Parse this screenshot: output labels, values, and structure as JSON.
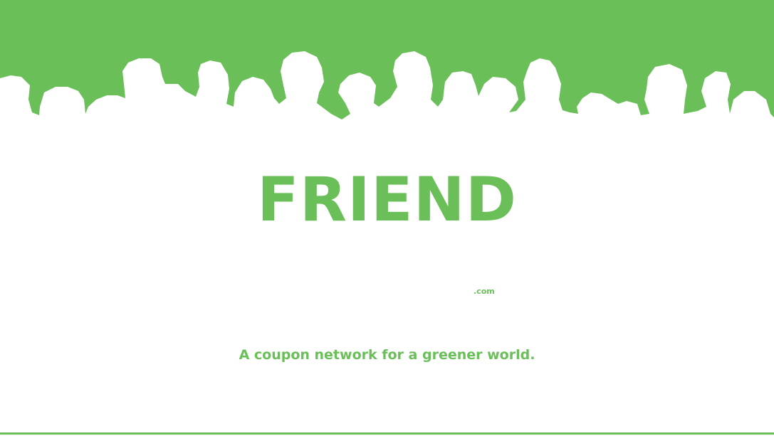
{
  "brand": {
    "name": "FRIEND",
    "domain_suffix": ".com",
    "tagline": "A coupon network for a greener world."
  },
  "colors": {
    "accent": "#6abf59",
    "background": "#ffffff"
  },
  "graphics": {
    "header": "crowd-silhouettes"
  }
}
